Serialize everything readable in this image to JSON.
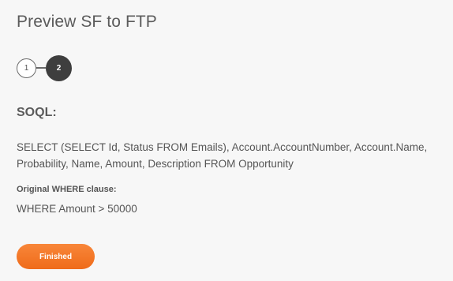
{
  "dialog": {
    "title": "Preview SF to FTP"
  },
  "stepper": {
    "steps": [
      {
        "label": "1",
        "state": "completed"
      },
      {
        "label": "2",
        "state": "active"
      }
    ]
  },
  "soql": {
    "heading": "SOQL:",
    "query": "SELECT (SELECT Id, Status FROM Emails), Account.AccountNumber, Account.Name, Probability, Name, Amount, Description FROM Opportunity",
    "where_label": "Original WHERE clause:",
    "where_value": "WHERE Amount > 50000"
  },
  "actions": {
    "finished_label": "Finished"
  },
  "colors": {
    "accent": "#f27625",
    "active_step": "#3e3e3e",
    "panel_background": "#f7f7f7"
  }
}
